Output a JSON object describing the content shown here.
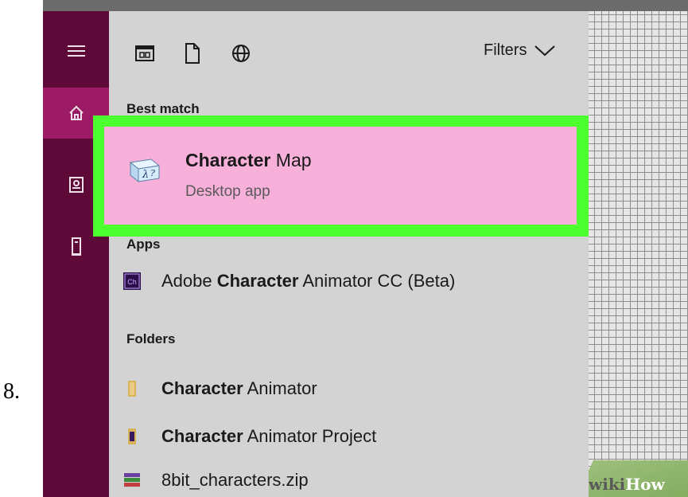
{
  "step_number": "8.",
  "sidebar": {
    "items": [
      {
        "icon": "hamburger-icon",
        "active": false
      },
      {
        "icon": "home-icon",
        "active": true
      },
      {
        "icon": "notebook-icon",
        "active": false
      },
      {
        "icon": "tower-icon",
        "active": false
      }
    ]
  },
  "filterbar": {
    "icons": [
      "apps-icon",
      "document-icon",
      "web-globe-icon"
    ],
    "filters_label": "Filters"
  },
  "sections": {
    "best_match": "Best match",
    "apps": "Apps",
    "folders": "Folders"
  },
  "best_match": {
    "title_bold": "Character",
    "title_rest": " Map",
    "subtitle": "Desktop app"
  },
  "apps": [
    {
      "prefix": "Adobe ",
      "bold": "Character",
      "rest": " Animator CC (Beta)",
      "icon": "adobe-character-animator-icon"
    }
  ],
  "folders": [
    {
      "prefix": "",
      "bold": "Character",
      "rest": " Animator",
      "icon": "folder-icon"
    },
    {
      "prefix": "",
      "bold": "Character",
      "rest": " Animator Project",
      "icon": "folder-icon"
    },
    {
      "prefix": "",
      "bold": "",
      "rest": "8bit_characters.zip",
      "icon": "zip-archive-icon"
    }
  ],
  "watermark": {
    "part1": "wiki",
    "part2": "How"
  },
  "colors": {
    "sidebar": "#5d0a39",
    "sidebar_active": "#9c1a66",
    "panel": "#d3d3d3",
    "highlight_border": "#4cff2e",
    "highlight_fill": "#f7b0da"
  }
}
